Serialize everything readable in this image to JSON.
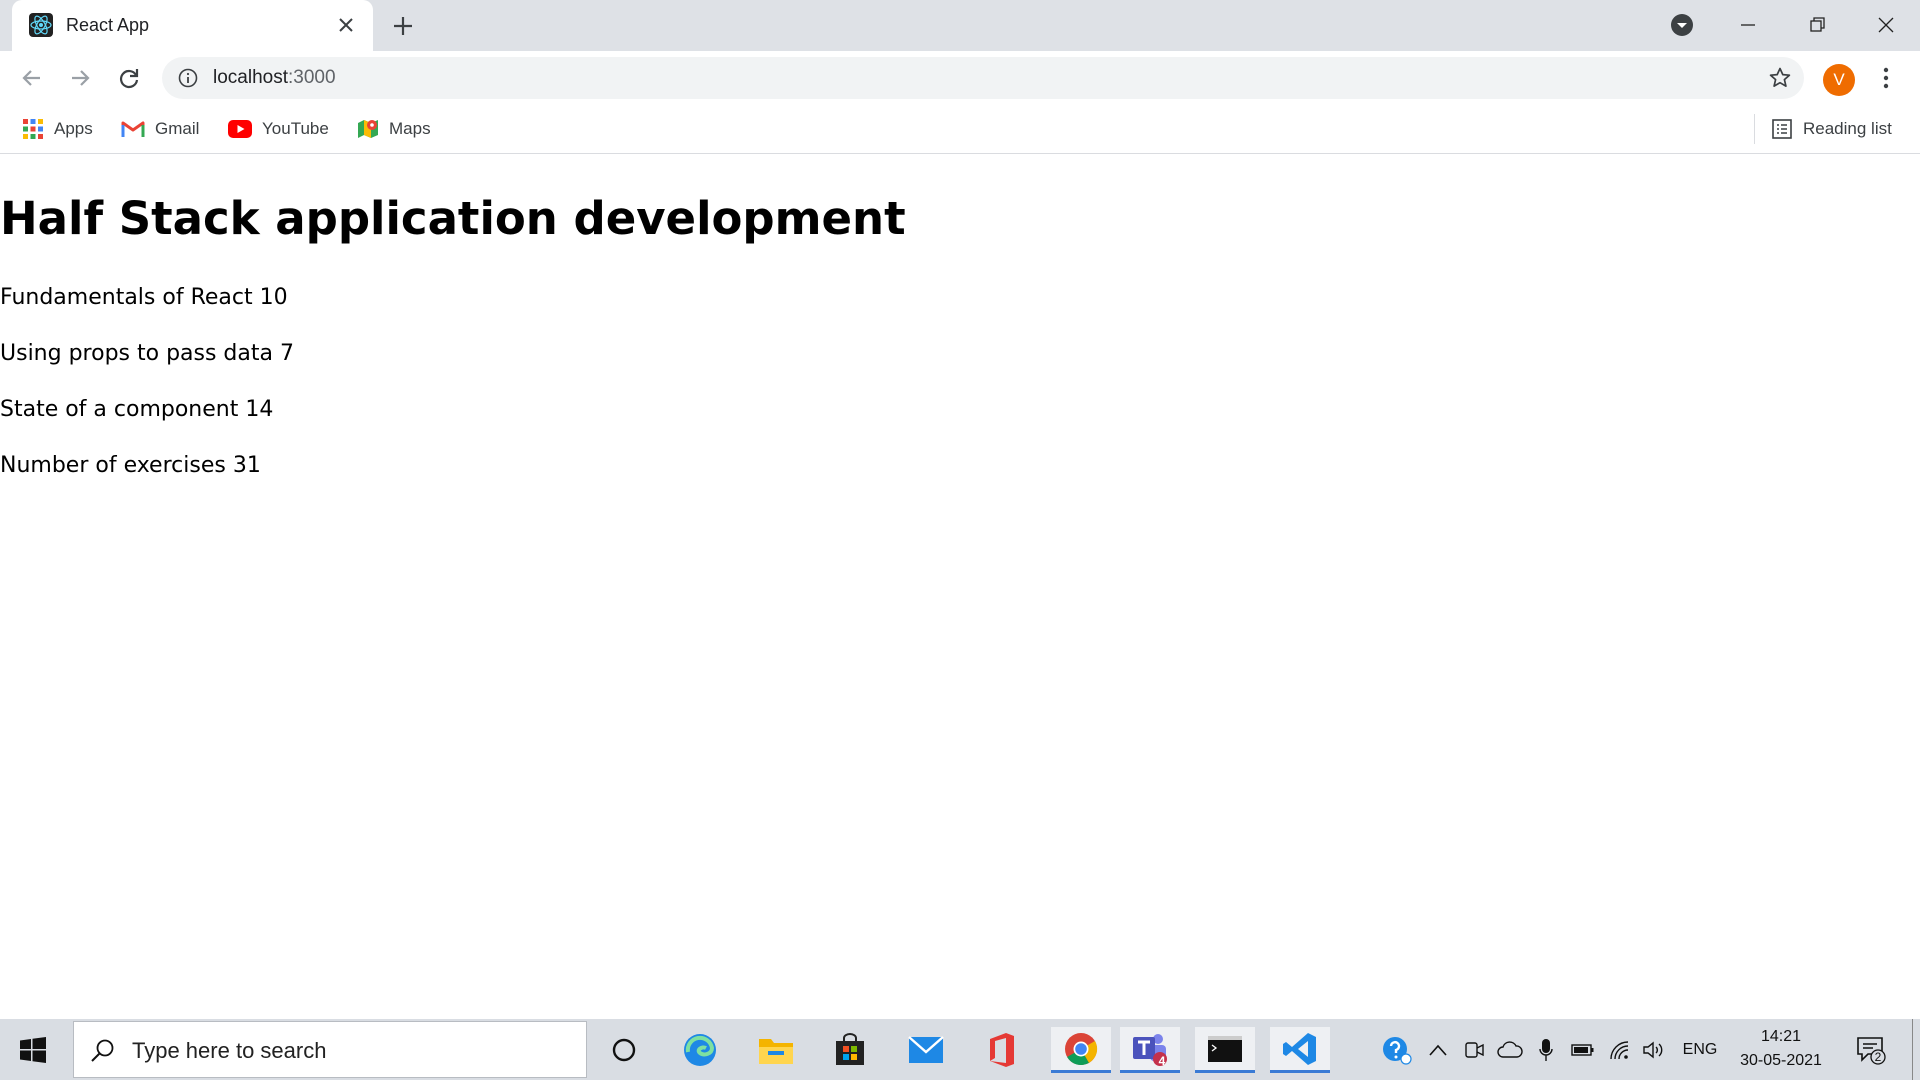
{
  "browser": {
    "tab": {
      "title": "React App"
    },
    "address": {
      "host": "localhost",
      "port": ":3000"
    },
    "profile_initial": "V",
    "bookmarks": [
      {
        "label": "Apps"
      },
      {
        "label": "Gmail"
      },
      {
        "label": "YouTube"
      },
      {
        "label": "Maps"
      }
    ],
    "reading_list": "Reading list"
  },
  "page": {
    "header": "Half Stack application development",
    "parts": [
      {
        "text": "Fundamentals of React 10"
      },
      {
        "text": "Using props to pass data 7"
      },
      {
        "text": "State of a component 14"
      }
    ],
    "total": "Number of exercises 31"
  },
  "taskbar": {
    "search_placeholder": "Type here to search",
    "teams_badge": "4",
    "language": "ENG",
    "time": "14:21",
    "date": "30-05-2021",
    "notification_count": "2"
  },
  "colors": {
    "tab_strip": "#dee1e6",
    "avatar": "#ef6c00",
    "taskbar": "#d9dde3",
    "active_indicator": "#3a7bd5"
  }
}
